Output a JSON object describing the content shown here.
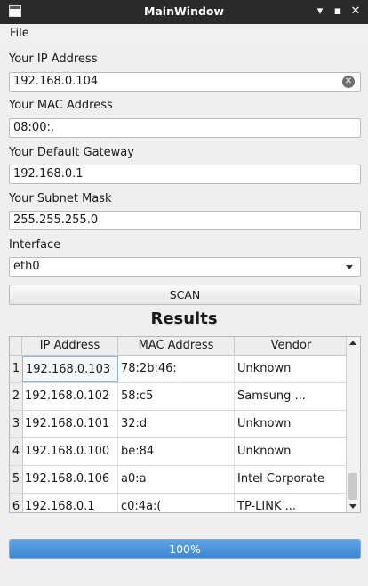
{
  "window": {
    "title": "MainWindow"
  },
  "menu": {
    "file": "File"
  },
  "ip": {
    "label": "Your IP Address",
    "value": "192.168.0.104"
  },
  "mac": {
    "label": "Your MAC Address",
    "value": "08:00:."
  },
  "gateway": {
    "label": "Your Default Gateway",
    "value": "192.168.0.1"
  },
  "subnet": {
    "label": "Your Subnet Mask",
    "value": "255.255.255.0"
  },
  "interface": {
    "label": "Interface",
    "value": "eth0"
  },
  "scan": {
    "label": "SCAN"
  },
  "results": {
    "title": "Results",
    "headers": [
      "IP Address",
      "MAC Address",
      "Vendor"
    ],
    "rows": [
      {
        "num": "1",
        "ip": "192.168.0.103",
        "mac": "78:2b:46:",
        "vendor": "Unknown"
      },
      {
        "num": "2",
        "ip": "192.168.0.102",
        "mac": "58:c5",
        "vendor": "Samsung ..."
      },
      {
        "num": "3",
        "ip": "192.168.0.101",
        "mac": "32:d",
        "vendor": "Unknown"
      },
      {
        "num": "4",
        "ip": "192.168.0.100",
        "mac": "be:84",
        "vendor": "Unknown"
      },
      {
        "num": "5",
        "ip": "192.168.0.106",
        "mac": "a0:a",
        "vendor": "Intel Corporate"
      },
      {
        "num": "6",
        "ip": "192.168.0.1",
        "mac": "c0:4a:(",
        "vendor": "TP-LINK ..."
      }
    ]
  },
  "progress": {
    "value": 100,
    "text": "100%"
  },
  "colors": {
    "accent": "#3b86d3",
    "titlebar": "#2a2a2a"
  }
}
